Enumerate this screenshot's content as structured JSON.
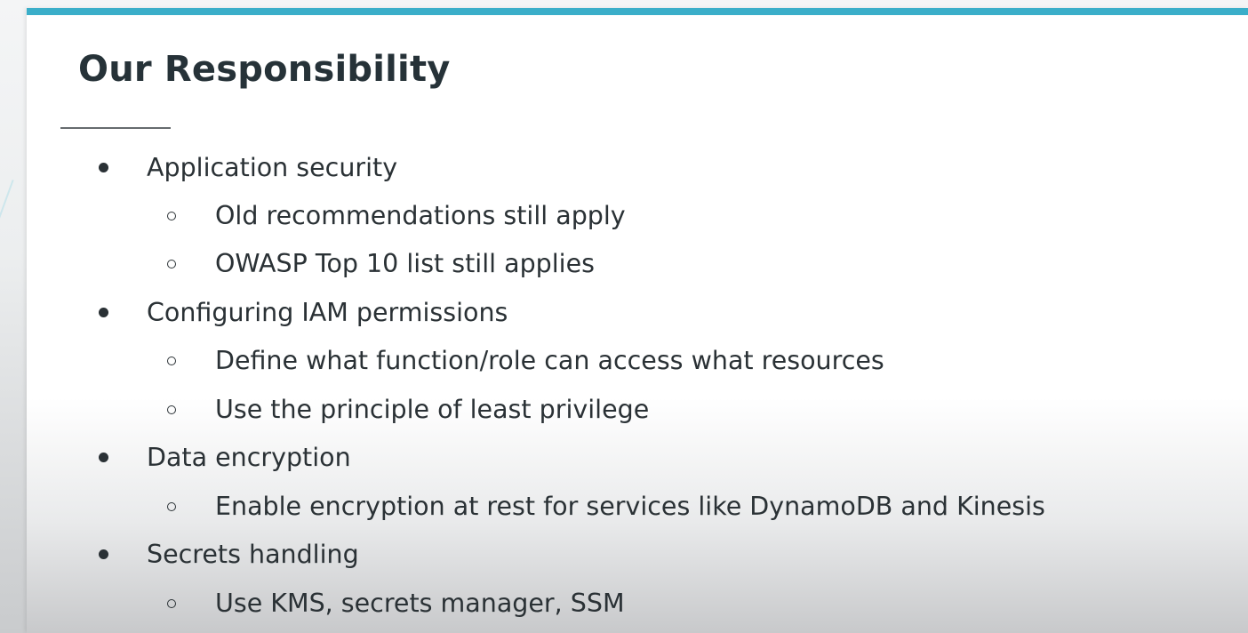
{
  "slide": {
    "title": "Our Responsibility",
    "accent_color": "#3aaec9",
    "bullets": [
      {
        "level": 1,
        "text": "Application security"
      },
      {
        "level": 2,
        "text": "Old recommendations still apply"
      },
      {
        "level": 2,
        "text": "OWASP Top 10 list still applies"
      },
      {
        "level": 1,
        "text": "Configuring IAM permissions"
      },
      {
        "level": 2,
        "text": "Define what function/role can access what resources"
      },
      {
        "level": 2,
        "text": "Use the principle of least privilege"
      },
      {
        "level": 1,
        "text": "Data encryption"
      },
      {
        "level": 2,
        "text": "Enable encryption at rest for services like DynamoDB and Kinesis"
      },
      {
        "level": 1,
        "text": "Secrets handling"
      },
      {
        "level": 2,
        "text": "Use KMS, secrets manager, SSM"
      }
    ]
  }
}
